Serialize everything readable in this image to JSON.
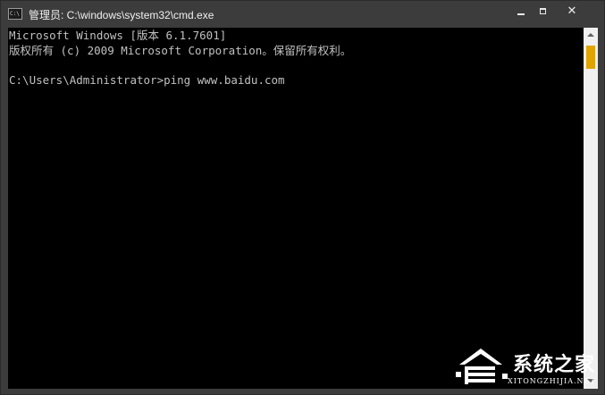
{
  "window": {
    "title": "管理员: C:\\windows\\system32\\cmd.exe",
    "icon_text": "C:\\"
  },
  "controls": {
    "minimize": "minimize-icon",
    "maximize": "maximize-icon",
    "close": "✕"
  },
  "console": {
    "lines": [
      "Microsoft Windows [版本 6.1.7601]",
      "版权所有 (c) 2009 Microsoft Corporation。保留所有权利。",
      "C:\\Users\\Administrator>ping www.baidu.com"
    ],
    "background": "#000000",
    "foreground": "#c0c0c0"
  },
  "scrollbar": {
    "thumb_color": "#e0a400"
  },
  "watermark": {
    "text": "系统之家",
    "sub": "XITONGZHIJIA.NET"
  }
}
